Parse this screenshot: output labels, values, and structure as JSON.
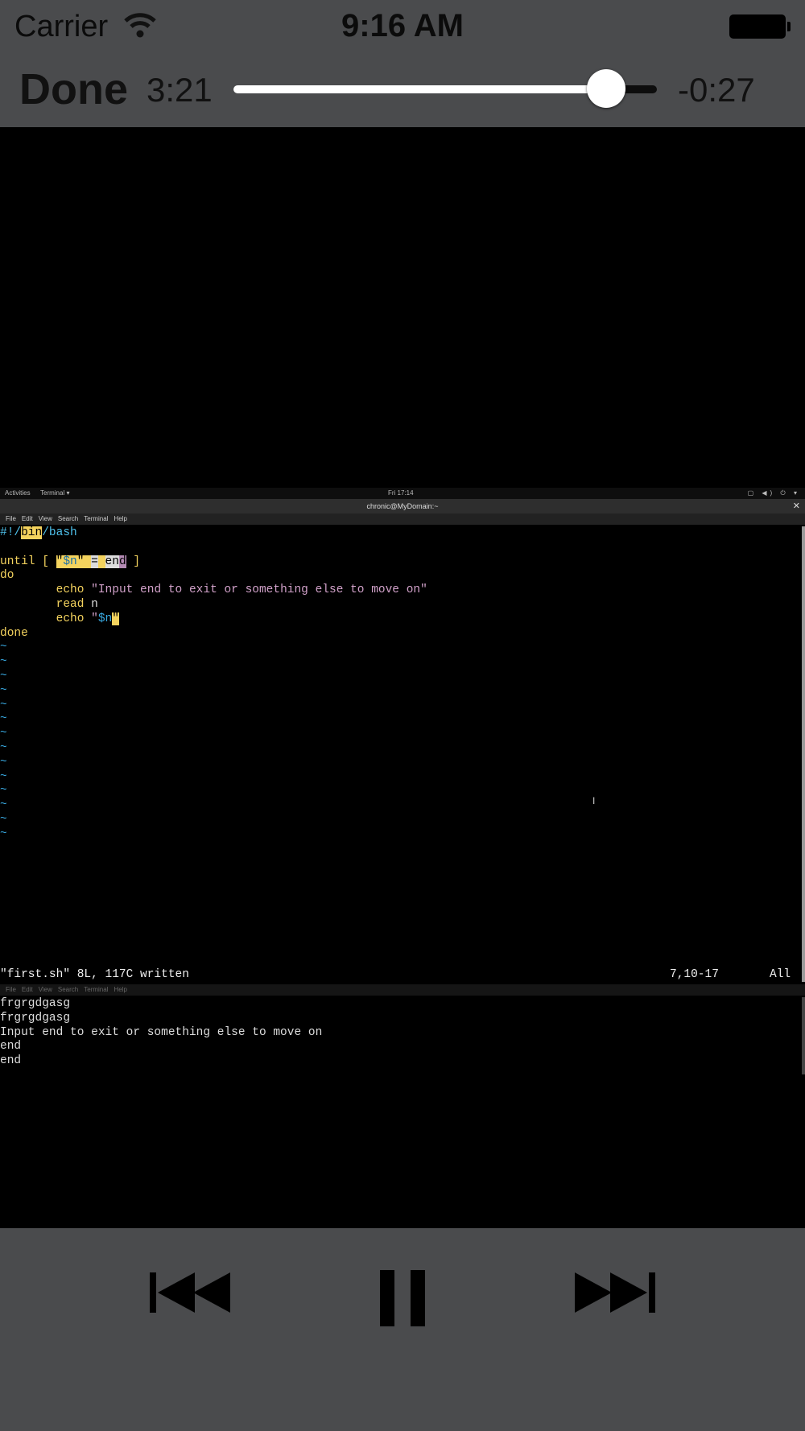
{
  "status_bar": {
    "carrier": "Carrier",
    "time": "9:16 AM",
    "icons": [
      "wifi-icon",
      "battery-icon"
    ]
  },
  "player": {
    "done_label": "Done",
    "elapsed": "3:21",
    "remaining": "-0:27",
    "progress_fraction": 0.88
  },
  "gnome_bar": {
    "activities": "Activities",
    "app_menu": "Terminal ▾",
    "clock": "Fri 17:14",
    "system_icons": "▢ ◀) ⏻ ▾"
  },
  "terminal": {
    "title": "chronic@MyDomain:~",
    "menu": [
      "File",
      "Edit",
      "View",
      "Search",
      "Terminal",
      "Help"
    ],
    "vim_status": "\"first.sh\" 8L, 117C written",
    "vim_position": "7,10-17",
    "vim_scroll": "All",
    "output_lines": [
      "frgrgdgasg",
      "frgrgdgasg",
      "Input end to exit or something else to move on",
      "end",
      "end"
    ]
  },
  "controls": {
    "icons": [
      "previous-track-icon",
      "pause-icon",
      "next-track-icon"
    ]
  },
  "colors": {
    "chrome": "#4a4b4d",
    "vim_yellow": "#f4d35e",
    "vim_cyan": "#4ec0ea",
    "vim_pink": "#d0a0c8"
  }
}
